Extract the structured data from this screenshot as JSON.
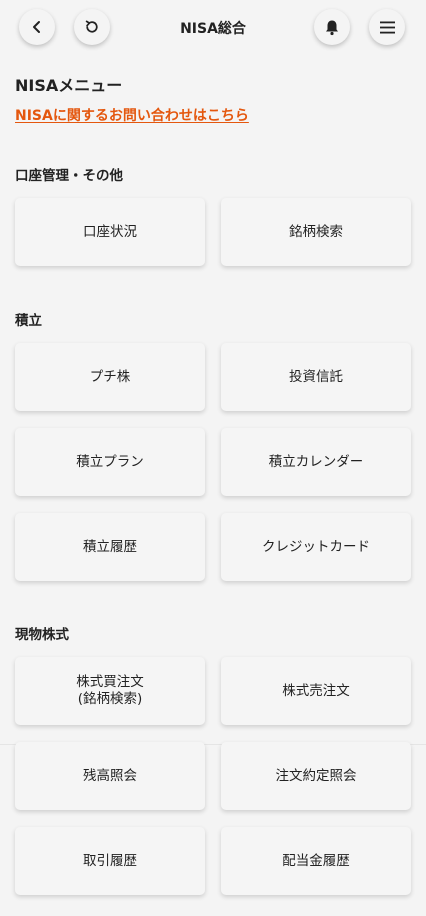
{
  "header": {
    "title": "NISA総合",
    "back_icon": "chevron-left-icon",
    "refresh_icon": "refresh-icon",
    "bell_icon": "bell-icon",
    "menu_icon": "hamburger-icon"
  },
  "page": {
    "menu_title": "NISAメニュー",
    "inquiry_link": "NISAに関するお問い合わせはこちら"
  },
  "colors": {
    "link": "#e4570e",
    "background": "#f4f4f4"
  },
  "sections": {
    "account": {
      "title": "口座管理・その他",
      "items": [
        "口座状況",
        "銘柄検索"
      ]
    },
    "tsumitate": {
      "title": "積立",
      "items": [
        "プチ株",
        "投資信託",
        "積立プラン",
        "積立カレンダー",
        "積立履歴",
        "クレジットカード"
      ]
    },
    "stocks": {
      "title": "現物株式",
      "items": [
        "株式買注文\n(銘柄検索)",
        "株式売注文",
        "残高照会",
        "注文約定照会",
        "取引履歴",
        "配当金履歴"
      ]
    }
  }
}
